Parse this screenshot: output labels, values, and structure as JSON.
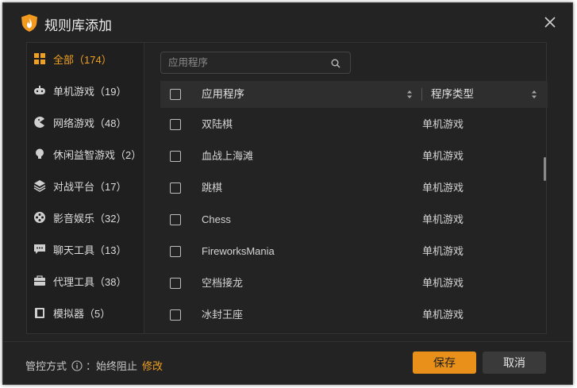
{
  "window": {
    "title": "规则库添加"
  },
  "sidebar": {
    "items": [
      {
        "label": "全部（174）",
        "icon": "grid-icon",
        "active": true
      },
      {
        "label": "单机游戏（19）",
        "icon": "gamepad-icon"
      },
      {
        "label": "网络游戏（48）",
        "icon": "pacman-icon"
      },
      {
        "label": "休闲益智游戏（2）",
        "icon": "bulb-icon"
      },
      {
        "label": "对战平台（17）",
        "icon": "layers-icon"
      },
      {
        "label": "影音娱乐（32）",
        "icon": "film-reel-icon"
      },
      {
        "label": "聊天工具（13）",
        "icon": "chat-icon"
      },
      {
        "label": "代理工具（38）",
        "icon": "briefcase-icon"
      },
      {
        "label": "模拟器（5）",
        "icon": "device-icon"
      }
    ]
  },
  "search": {
    "placeholder": "应用程序"
  },
  "table": {
    "headers": {
      "name": "应用程序",
      "type": "程序类型"
    },
    "rows": [
      {
        "name": "双陆棋",
        "type": "单机游戏"
      },
      {
        "name": "血战上海滩",
        "type": "单机游戏"
      },
      {
        "name": "跳棋",
        "type": "单机游戏"
      },
      {
        "name": "Chess",
        "type": "单机游戏"
      },
      {
        "name": "FireworksMania",
        "type": "单机游戏"
      },
      {
        "name": "空档接龙",
        "type": "单机游戏"
      },
      {
        "name": "冰封王座",
        "type": "单机游戏"
      }
    ]
  },
  "footer": {
    "policy_label": "管控方式",
    "policy_value": "：始终阻止",
    "modify_label": "修改",
    "save_label": "保存",
    "cancel_label": "取消"
  },
  "colors": {
    "accent": "#e89019",
    "background": "#232323",
    "sidebar": "#1f1f1f",
    "header": "#2e2e2e"
  }
}
